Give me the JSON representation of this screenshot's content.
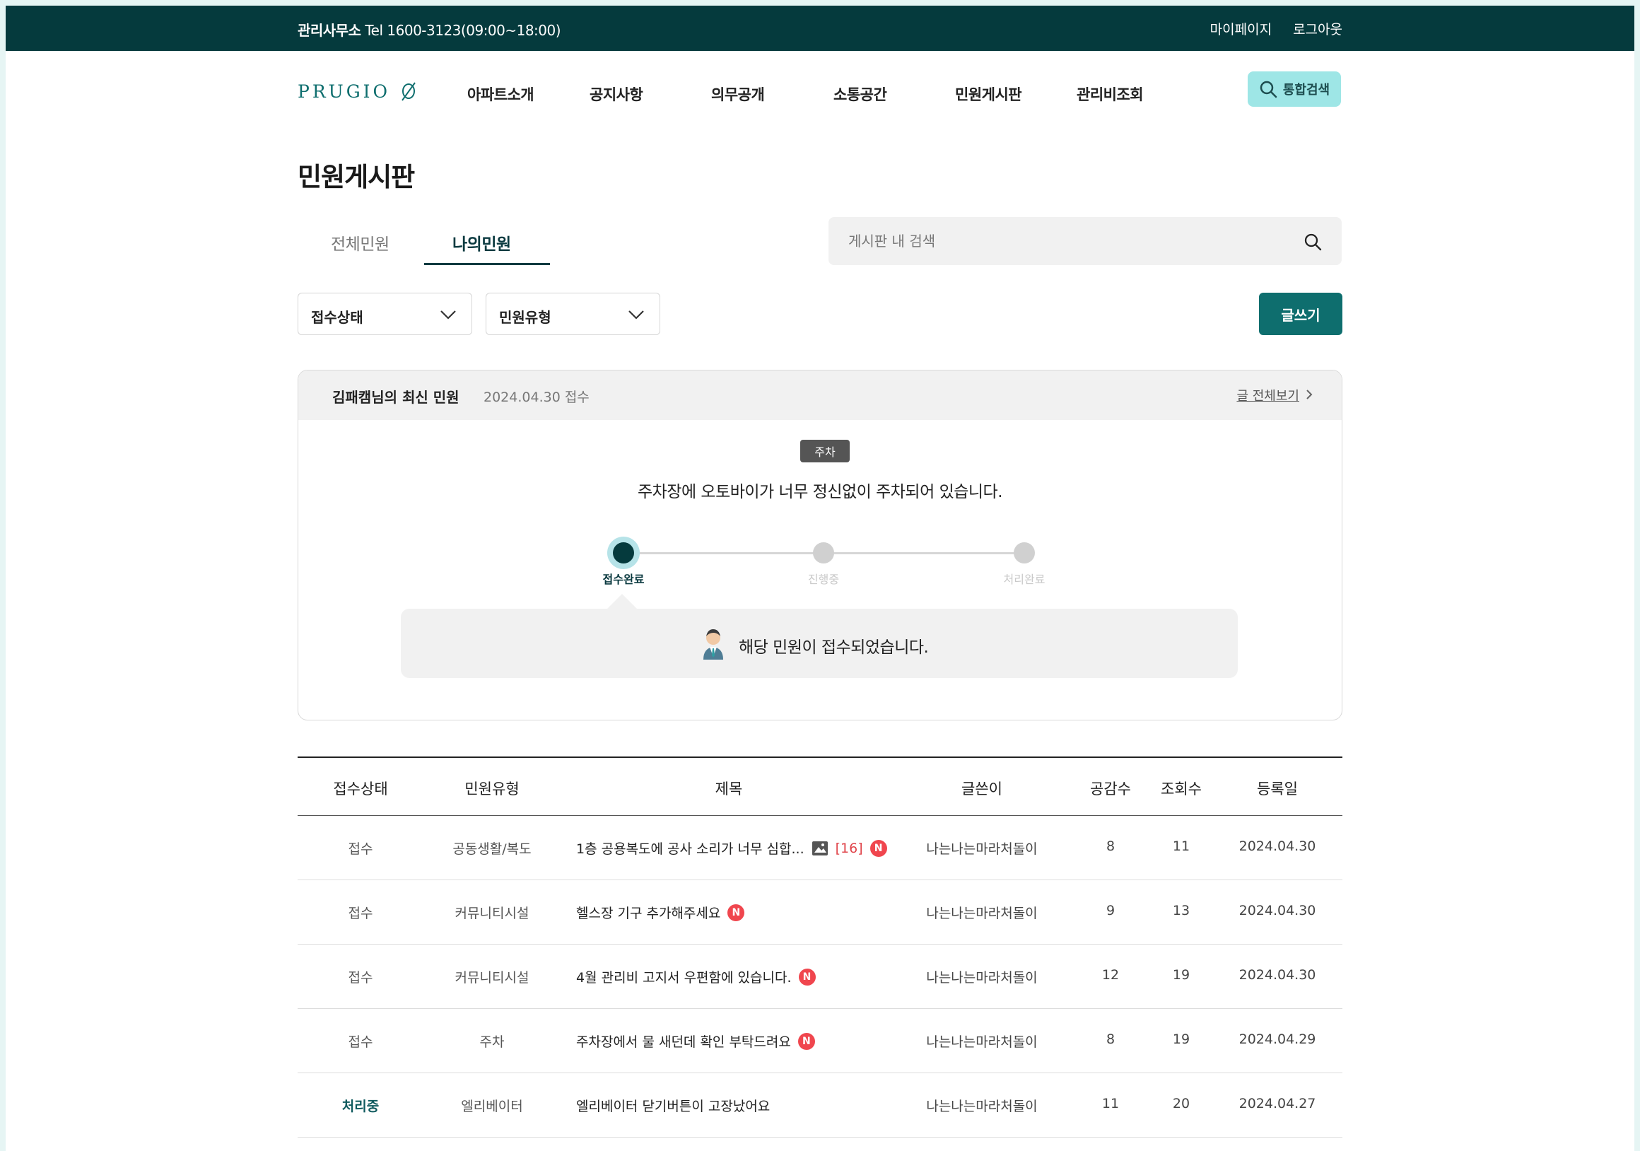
{
  "topbar": {
    "office_label": "관리사무소",
    "office_contact": "Tel 1600-3123(09:00~18:00)",
    "mypage": "마이페이지",
    "logout": "로그아웃"
  },
  "header": {
    "logo_text": "PRUGIO",
    "nav": [
      "아파트소개",
      "공지사항",
      "의무공개",
      "소통공간",
      "민원게시판",
      "관리비조회"
    ],
    "search_all": "통합검색"
  },
  "page": {
    "title": "민원게시판",
    "tabs": [
      {
        "label": "전체민원",
        "active": false
      },
      {
        "label": "나의민원",
        "active": true
      }
    ],
    "search_placeholder": "게시판 내 검색"
  },
  "filters": {
    "status_select": "접수상태",
    "type_select": "민원유형",
    "write_button": "글쓰기"
  },
  "latest": {
    "owner": "김패캠님의 최신 민원",
    "date": "2024.04.30 접수",
    "view_all": "글 전체보기",
    "tag": "주차",
    "title": "주차장에 오토바이가 너무 정신없이 주차되어 있습니다.",
    "steps": [
      "접수완료",
      "진행중",
      "처리완료"
    ],
    "current_step": 0,
    "message": "해당 민원이 접수되었습니다."
  },
  "table": {
    "headers": [
      "접수상태",
      "민원유형",
      "제목",
      "글쓴이",
      "공감수",
      "조회수",
      "등록일"
    ],
    "rows": [
      {
        "status": "접수",
        "type": "공동생활/복도",
        "title": "1층 공용복도에 공사 소리가 너무 심합...",
        "has_image": true,
        "comments": "[16]",
        "is_new": true,
        "new_label": "N",
        "author": "나는나는마라처돌이",
        "likes": "8",
        "views": "11",
        "date": "2024.04.30"
      },
      {
        "status": "접수",
        "type": "커뮤니티시설",
        "title": "헬스장 기구 추가해주세요",
        "has_image": false,
        "comments": "",
        "is_new": true,
        "new_label": "N",
        "author": "나는나는마라처돌이",
        "likes": "9",
        "views": "13",
        "date": "2024.04.30"
      },
      {
        "status": "접수",
        "type": "커뮤니티시설",
        "title": "4월 관리비 고지서 우편함에 있습니다.",
        "has_image": false,
        "comments": "",
        "is_new": true,
        "new_label": "N",
        "author": "나는나는마라처돌이",
        "likes": "12",
        "views": "19",
        "date": "2024.04.30"
      },
      {
        "status": "접수",
        "type": "주차",
        "title": "주차장에서 물 새던데 확인 부탁드려요",
        "has_image": false,
        "comments": "",
        "is_new": true,
        "new_label": "N",
        "author": "나는나는마라처돌이",
        "likes": "8",
        "views": "19",
        "date": "2024.04.29"
      },
      {
        "status": "처리중",
        "type": "엘리베이터",
        "title": "엘리베이터 닫기버튼이 고장났어요",
        "has_image": false,
        "comments": "",
        "is_new": false,
        "new_label": "",
        "author": "나는나는마라처돌이",
        "likes": "11",
        "views": "20",
        "date": "2024.04.27"
      }
    ]
  },
  "colors": {
    "primary_dark": "#053a3d",
    "primary": "#0e6e6e",
    "accent_light": "#9ee6e6",
    "new_badge": "#f0464e"
  }
}
